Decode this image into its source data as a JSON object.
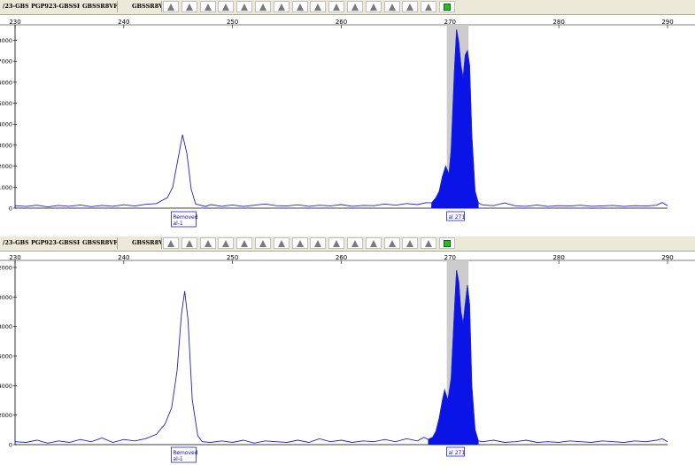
{
  "panels": [
    {
      "id": "top",
      "toolbar": {
        "labels": [
          "/23-GBSS",
          "PGP923-GBSSR8V",
          "GBSSR8VF",
          "GBSSR8VF"
        ],
        "buttons": [
          {
            "icon": "triangle-icon"
          },
          {
            "icon": "triangle-icon"
          },
          {
            "icon": "triangle-icon"
          },
          {
            "icon": "triangle-icon"
          },
          {
            "icon": "triangle-icon"
          },
          {
            "icon": "triangle-icon"
          },
          {
            "icon": "triangle-icon"
          },
          {
            "icon": "triangle-icon"
          },
          {
            "icon": "triangle-icon"
          },
          {
            "icon": "triangle-icon"
          },
          {
            "icon": "triangle-icon"
          },
          {
            "icon": "triangle-icon"
          },
          {
            "icon": "triangle-icon"
          },
          {
            "icon": "triangle-icon"
          },
          {
            "icon": "triangle-icon"
          },
          {
            "icon": "green-square-icon"
          }
        ]
      },
      "peak_labels": [
        {
          "lines": [
            "Removed",
            "al-1"
          ],
          "x": 245.5
        },
        {
          "lines": [
            "al 271"
          ],
          "x": 270.5
        }
      ]
    },
    {
      "id": "bottom",
      "toolbar": {
        "labels": [
          "/23-GBSS",
          "PGP923-GBSSR8V",
          "GBSSR8VF",
          "GBSSR8VF"
        ],
        "buttons": [
          {
            "icon": "triangle-icon"
          },
          {
            "icon": "triangle-icon"
          },
          {
            "icon": "triangle-icon"
          },
          {
            "icon": "triangle-icon"
          },
          {
            "icon": "triangle-icon"
          },
          {
            "icon": "triangle-icon"
          },
          {
            "icon": "triangle-icon"
          },
          {
            "icon": "triangle-icon"
          },
          {
            "icon": "triangle-icon"
          },
          {
            "icon": "triangle-icon"
          },
          {
            "icon": "triangle-icon"
          },
          {
            "icon": "triangle-icon"
          },
          {
            "icon": "triangle-icon"
          },
          {
            "icon": "triangle-icon"
          },
          {
            "icon": "triangle-icon"
          },
          {
            "icon": "green-square-icon"
          }
        ]
      },
      "peak_labels": [
        {
          "lines": [
            "Removed",
            "al-1"
          ],
          "x": 245.5
        },
        {
          "lines": [
            "al 271"
          ],
          "x": 270.5
        }
      ]
    }
  ],
  "chart_data": [
    {
      "type": "line",
      "xlim": [
        230,
        290
      ],
      "ylim": [
        0,
        8400
      ],
      "x_ticks": [
        230,
        240,
        250,
        260,
        270,
        280,
        290
      ],
      "y_ticks": [
        0,
        1000,
        2000,
        3000,
        4000,
        5000,
        6000,
        7000,
        8000
      ],
      "y_tick_labels": [
        "0",
        "1000",
        "2000",
        "3000",
        "4000",
        "5000",
        "6000",
        "7000",
        "8000"
      ],
      "grid": false,
      "line_color": "#2020d0",
      "fill_color": "#0a14e6",
      "bin_color": "#cccccc",
      "bin_range": [
        269.7,
        271.7
      ],
      "filled_range": [
        268.2,
        272.6
      ],
      "series": [
        {
          "points": [
            [
              230,
              120
            ],
            [
              231,
              80
            ],
            [
              232,
              140
            ],
            [
              233,
              60
            ],
            [
              234,
              130
            ],
            [
              235,
              90
            ],
            [
              236,
              150
            ],
            [
              237,
              70
            ],
            [
              238,
              130
            ],
            [
              239,
              90
            ],
            [
              240,
              160
            ],
            [
              241,
              100
            ],
            [
              242,
              180
            ],
            [
              243,
              220
            ],
            [
              244,
              500
            ],
            [
              244.5,
              1000
            ],
            [
              245,
              2400
            ],
            [
              245.4,
              3500
            ],
            [
              245.8,
              2600
            ],
            [
              246.2,
              900
            ],
            [
              246.6,
              200
            ],
            [
              247.5,
              80
            ],
            [
              248,
              170
            ],
            [
              249,
              90
            ],
            [
              250,
              150
            ],
            [
              251,
              80
            ],
            [
              252,
              140
            ],
            [
              253,
              200
            ],
            [
              254,
              120
            ],
            [
              255,
              100
            ],
            [
              256,
              160
            ],
            [
              257,
              90
            ],
            [
              258,
              140
            ],
            [
              259,
              110
            ],
            [
              260,
              170
            ],
            [
              261,
              90
            ],
            [
              262,
              130
            ],
            [
              263,
              120
            ],
            [
              264,
              200
            ],
            [
              265,
              140
            ],
            [
              266,
              220
            ],
            [
              267,
              170
            ],
            [
              267.8,
              260
            ],
            [
              268.3,
              250
            ],
            [
              268.7,
              500
            ],
            [
              269.0,
              800
            ],
            [
              269.3,
              1500
            ],
            [
              269.6,
              2000
            ],
            [
              269.9,
              1600
            ],
            [
              270.1,
              2800
            ],
            [
              270.4,
              6500
            ],
            [
              270.6,
              8500
            ],
            [
              270.8,
              7900
            ],
            [
              271.0,
              6800
            ],
            [
              271.2,
              6200
            ],
            [
              271.4,
              7300
            ],
            [
              271.6,
              7500
            ],
            [
              271.8,
              6800
            ],
            [
              272.0,
              3500
            ],
            [
              272.3,
              800
            ],
            [
              272.6,
              250
            ],
            [
              273,
              150
            ],
            [
              274,
              120
            ],
            [
              275,
              250
            ],
            [
              276,
              110
            ],
            [
              277,
              90
            ],
            [
              278,
              150
            ],
            [
              279,
              80
            ],
            [
              280,
              120
            ],
            [
              281,
              100
            ],
            [
              282,
              140
            ],
            [
              283,
              90
            ],
            [
              284,
              110
            ],
            [
              285,
              130
            ],
            [
              286,
              80
            ],
            [
              287,
              120
            ],
            [
              288,
              100
            ],
            [
              289,
              140
            ],
            [
              289.5,
              270
            ],
            [
              290,
              120
            ]
          ]
        }
      ]
    },
    {
      "type": "line",
      "xlim": [
        230,
        290
      ],
      "ylim": [
        0,
        12000
      ],
      "x_ticks": [
        230,
        240,
        250,
        260,
        270,
        280,
        290
      ],
      "y_ticks": [
        0,
        2000,
        4000,
        6000,
        8000,
        10000,
        12000
      ],
      "y_tick_labels": [
        "0",
        "2000",
        "4000",
        "6000",
        "8000",
        "0000",
        "2000"
      ],
      "grid": false,
      "line_color": "#2020d0",
      "fill_color": "#0a14e6",
      "bin_color": "#cccccc",
      "bin_range": [
        269.7,
        271.7
      ],
      "filled_range": [
        268.0,
        272.6
      ],
      "series": [
        {
          "points": [
            [
              230,
              200
            ],
            [
              231,
              150
            ],
            [
              232,
              300
            ],
            [
              233,
              100
            ],
            [
              234,
              250
            ],
            [
              235,
              150
            ],
            [
              236,
              350
            ],
            [
              237,
              200
            ],
            [
              238,
              450
            ],
            [
              239,
              150
            ],
            [
              240,
              350
            ],
            [
              241,
              250
            ],
            [
              242,
              400
            ],
            [
              243,
              700
            ],
            [
              243.8,
              1400
            ],
            [
              244.4,
              2500
            ],
            [
              244.9,
              5000
            ],
            [
              245.3,
              8800
            ],
            [
              245.6,
              10400
            ],
            [
              245.9,
              8500
            ],
            [
              246.3,
              3000
            ],
            [
              246.8,
              600
            ],
            [
              247.2,
              200
            ],
            [
              248,
              150
            ],
            [
              249,
              250
            ],
            [
              250,
              150
            ],
            [
              251,
              300
            ],
            [
              252,
              100
            ],
            [
              253,
              250
            ],
            [
              254,
              200
            ],
            [
              255,
              150
            ],
            [
              256,
              300
            ],
            [
              257,
              150
            ],
            [
              258,
              400
            ],
            [
              259,
              200
            ],
            [
              260,
              300
            ],
            [
              261,
              150
            ],
            [
              262,
              250
            ],
            [
              263,
              200
            ],
            [
              264,
              350
            ],
            [
              265,
              200
            ],
            [
              266,
              400
            ],
            [
              267,
              250
            ],
            [
              267.6,
              500
            ],
            [
              268.0,
              350
            ],
            [
              268.4,
              500
            ],
            [
              268.7,
              900
            ],
            [
              269.0,
              1800
            ],
            [
              269.3,
              3000
            ],
            [
              269.5,
              3700
            ],
            [
              269.8,
              3000
            ],
            [
              270.1,
              4500
            ],
            [
              270.4,
              9000
            ],
            [
              270.6,
              11800
            ],
            [
              270.8,
              11000
            ],
            [
              271.0,
              9000
            ],
            [
              271.2,
              8200
            ],
            [
              271.4,
              9500
            ],
            [
              271.6,
              10800
            ],
            [
              271.8,
              9500
            ],
            [
              272.0,
              4000
            ],
            [
              272.3,
              1000
            ],
            [
              272.6,
              250
            ],
            [
              273,
              200
            ],
            [
              274,
              300
            ],
            [
              275,
              150
            ],
            [
              276,
              200
            ],
            [
              277,
              300
            ],
            [
              278,
              150
            ],
            [
              279,
              200
            ],
            [
              280,
              150
            ],
            [
              281,
              250
            ],
            [
              282,
              200
            ],
            [
              283,
              150
            ],
            [
              284,
              250
            ],
            [
              285,
              200
            ],
            [
              286,
              150
            ],
            [
              287,
              250
            ],
            [
              288,
              200
            ],
            [
              289,
              300
            ],
            [
              289.5,
              400
            ],
            [
              290,
              200
            ]
          ]
        }
      ]
    }
  ]
}
